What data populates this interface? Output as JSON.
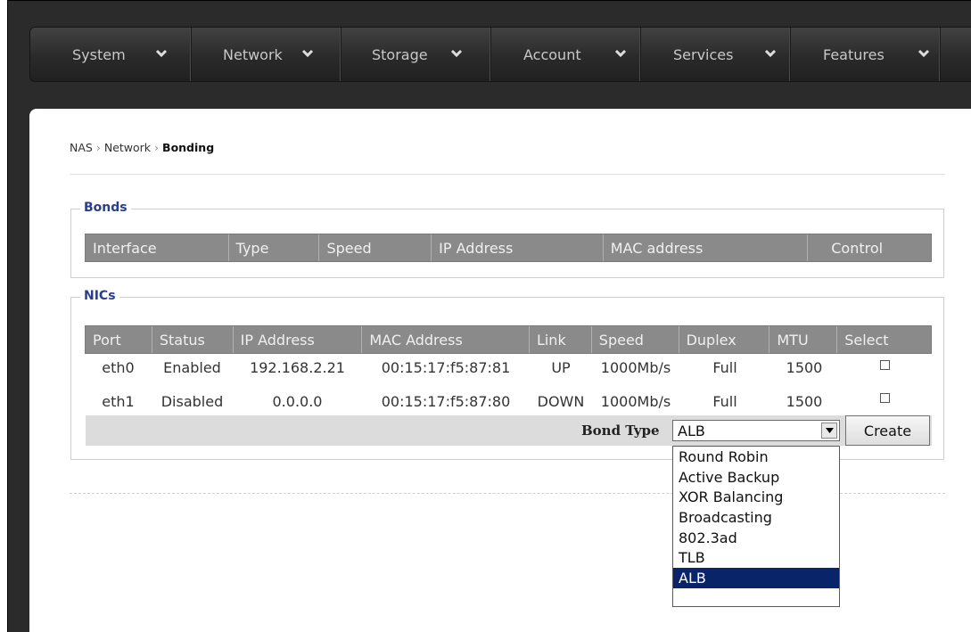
{
  "menu": [
    {
      "label": "System",
      "icon": "chevron-down-icon"
    },
    {
      "label": "Network",
      "icon": "chevron-down-icon"
    },
    {
      "label": "Storage",
      "icon": "chevron-down-icon"
    },
    {
      "label": "Account",
      "icon": "chevron-down-icon"
    },
    {
      "label": "Services",
      "icon": "chevron-down-icon"
    },
    {
      "label": "Features",
      "icon": "chevron-down-icon"
    }
  ],
  "breadcrumb": {
    "root": "NAS",
    "section": "Network",
    "current": "Bonding",
    "separator": "›"
  },
  "bonds": {
    "legend": "Bonds",
    "headers": [
      "Interface",
      "Type",
      "Speed",
      "IP Address",
      "MAC address",
      "Control"
    ]
  },
  "nics": {
    "legend": "NICs",
    "headers": [
      "Port",
      "Status",
      "IP Address",
      "MAC Address",
      "Link",
      "Speed",
      "Duplex",
      "MTU",
      "Select"
    ],
    "rows": [
      [
        "eth0",
        "Enabled",
        "192.168.2.21",
        "00:15:17:f5:87:81",
        "UP",
        "1000Mb/s",
        "Full",
        "1500"
      ],
      [
        "eth1",
        "Disabled",
        "0.0.0.0",
        "00:15:17:f5:87:80",
        "DOWN",
        "1000Mb/s",
        "Full",
        "1500"
      ]
    ]
  },
  "bond_type": {
    "label": "Bond Type",
    "selected": "ALB",
    "options": [
      "Round Robin",
      "Active Backup",
      "XOR Balancing",
      "Broadcasting",
      "802.3ad",
      "TLB",
      "ALB"
    ]
  },
  "create_label": "Create",
  "colors": {
    "legend": "#2a3e8f",
    "header": "#8a8a8a",
    "selected_option": "#0a246a"
  }
}
